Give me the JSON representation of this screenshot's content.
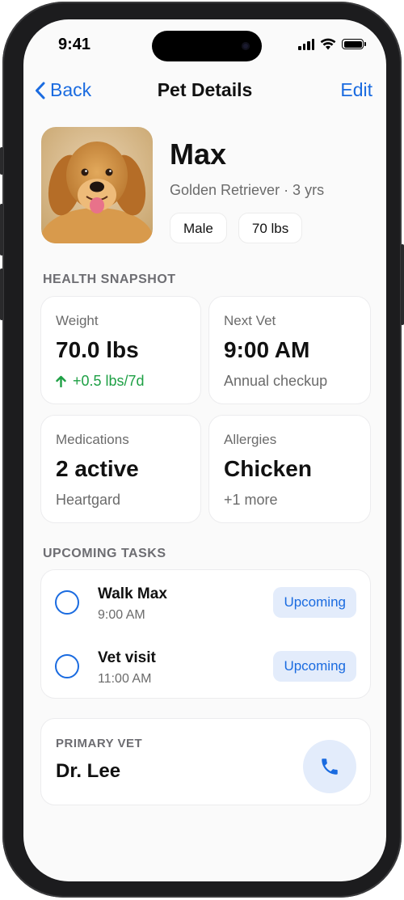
{
  "status_bar": {
    "time": "9:41"
  },
  "nav": {
    "back_label": "Back",
    "title": "Pet Details",
    "edit_label": "Edit"
  },
  "pet": {
    "name": "Max",
    "subtitle": "Golden Retriever · 3 yrs",
    "chips": [
      "Male",
      "70 lbs"
    ]
  },
  "health": {
    "section_title": "HEALTH SNAPSHOT",
    "weight": {
      "label": "Weight",
      "value": "70.0 lbs",
      "sub": "+0.5 lbs/7d",
      "trend_color": "#1ea045"
    },
    "next_vet": {
      "label": "Next Vet",
      "value": "9:00 AM",
      "sub": "Annual checkup"
    },
    "medications": {
      "label": "Medications",
      "value": "2 active",
      "sub": "Heartgard"
    },
    "allergies": {
      "label": "Allergies",
      "value": "Chicken",
      "sub": "+1 more"
    }
  },
  "tasks": {
    "section_title": "UPCOMING TASKS",
    "items": [
      {
        "title": "Walk Max",
        "time": "9:00 AM",
        "status": "Upcoming"
      },
      {
        "title": "Vet visit",
        "time": "11:00 AM",
        "status": "Upcoming"
      }
    ]
  },
  "vet": {
    "label": "PRIMARY VET",
    "name": "Dr. Lee"
  },
  "colors": {
    "accent": "#1a6be0",
    "accent_soft": "#e3ecfb",
    "positive": "#1ea045"
  },
  "icons": [
    "chevron-left-icon",
    "up-arrow-icon",
    "phone-icon",
    "signal-icon",
    "wifi-icon",
    "battery-icon"
  ]
}
